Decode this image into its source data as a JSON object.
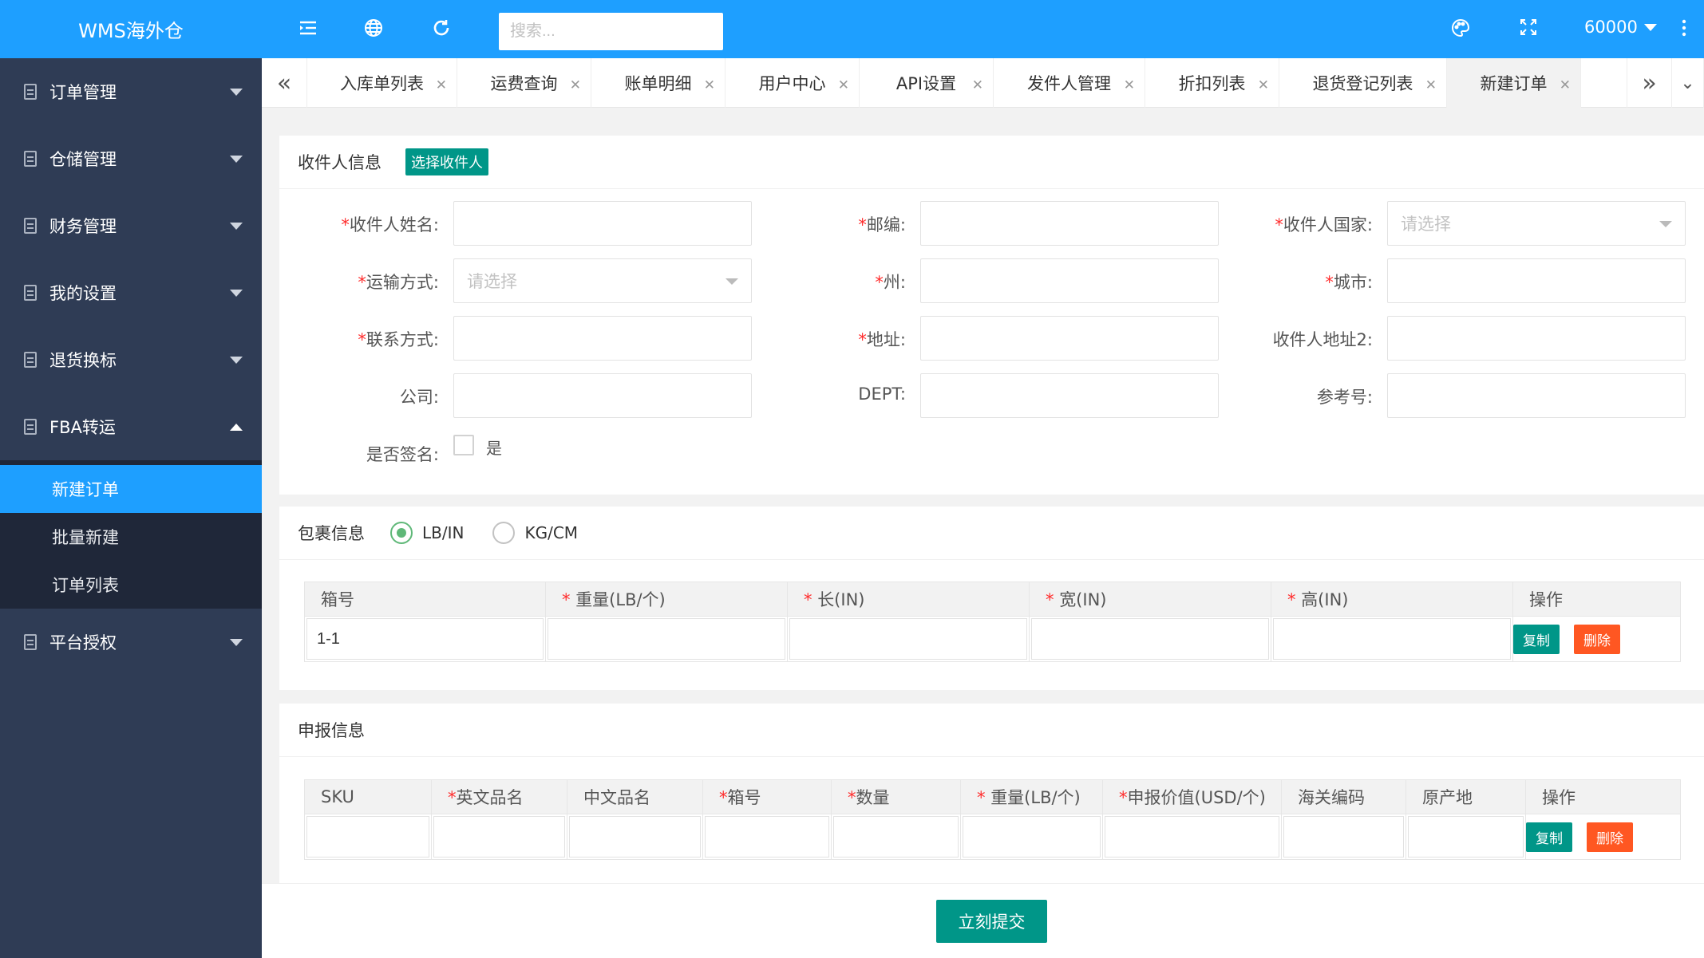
{
  "app": {
    "title": "WMS海外仓"
  },
  "topbar": {
    "search_placeholder": "搜索...",
    "user": "60000",
    "icons": [
      "menu-fold-icon",
      "globe-icon",
      "refresh-icon",
      "palette-icon",
      "fullscreen-icon",
      "more-vertical-icon"
    ]
  },
  "sidebar": {
    "items": [
      {
        "label": "订单管理"
      },
      {
        "label": "仓储管理"
      },
      {
        "label": "财务管理"
      },
      {
        "label": "我的设置"
      },
      {
        "label": "退货换标"
      },
      {
        "label": "FBA转运",
        "expanded": true
      },
      {
        "label": "平台授权"
      }
    ],
    "sub_items": [
      {
        "label": "新建订单",
        "active": true
      },
      {
        "label": "批量新建"
      },
      {
        "label": "订单列表"
      }
    ]
  },
  "tabs": [
    {
      "label": "入库单列表"
    },
    {
      "label": "运费查询"
    },
    {
      "label": "账单明细"
    },
    {
      "label": "用户中心"
    },
    {
      "label": "API设置"
    },
    {
      "label": "发件人管理"
    },
    {
      "label": "折扣列表"
    },
    {
      "label": "退货登记列表"
    },
    {
      "label": "新建订单",
      "active": true
    }
  ],
  "recipient": {
    "title": "收件人信息",
    "select_button": "选择收件人",
    "fields": {
      "name": {
        "label": "收件人姓名:",
        "required": "*"
      },
      "zip": {
        "label": "邮编:",
        "required": "*"
      },
      "country": {
        "label": "收件人国家:",
        "required": "*",
        "placeholder": "请选择"
      },
      "shipping": {
        "label": "运输方式:",
        "required": "*",
        "placeholder": "请选择"
      },
      "state": {
        "label": "州:",
        "required": "*"
      },
      "city": {
        "label": "城市:",
        "required": "*"
      },
      "contact": {
        "label": "联系方式:",
        "required": "*"
      },
      "address": {
        "label": "地址:",
        "required": "*"
      },
      "address2": {
        "label": "收件人地址2:"
      },
      "company": {
        "label": "公司:"
      },
      "dept": {
        "label": "DEPT:"
      },
      "reference": {
        "label": "参考号:"
      },
      "signature": {
        "label": "是否签名:",
        "option": "是",
        "checked": false
      }
    }
  },
  "package": {
    "title": "包裹信息",
    "units": [
      {
        "label": "LB/IN",
        "selected": true
      },
      {
        "label": "KG/CM",
        "selected": false
      }
    ],
    "columns": [
      "箱号",
      "重量(LB/个)",
      "长(IN)",
      "宽(IN)",
      "高(IN)",
      "操作"
    ],
    "required_mark": "* ",
    "rows": [
      {
        "box_no": "1-1",
        "weight": "",
        "length": "",
        "width": "",
        "height": ""
      }
    ],
    "copy_label": "复制",
    "delete_label": "删除"
  },
  "declaration": {
    "title": "申报信息",
    "columns": [
      "SKU",
      "英文品名",
      "中文品名",
      "箱号",
      "数量",
      "重量(LB/个)",
      "申报价值(USD/个)",
      "海关编码",
      "原产地",
      "操作"
    ],
    "rows": [
      {
        "sku": "",
        "en_name": "",
        "cn_name": "",
        "box_no": "",
        "qty": "",
        "weight": "",
        "value": "",
        "hs_code": "",
        "origin": ""
      }
    ],
    "copy_label": "复制",
    "delete_label": "删除"
  },
  "submit_label": "立刻提交"
}
